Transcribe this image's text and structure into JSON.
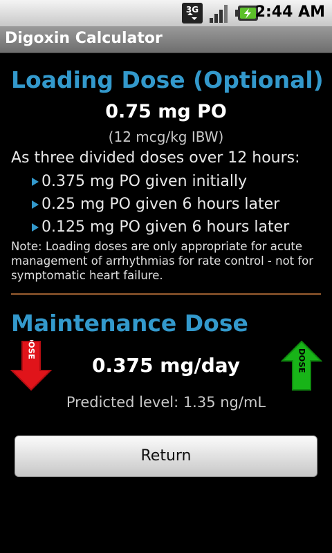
{
  "status_bar": {
    "time": "2:44 AM",
    "network": "3G",
    "icons": [
      "3g-data-icon",
      "signal-icon",
      "battery-charging-icon"
    ]
  },
  "title_bar": {
    "title": "Digoxin Calculator"
  },
  "loading": {
    "heading": "Loading Dose (Optional)",
    "dose": "0.75 mg PO",
    "sub": "(12 mcg/kg IBW)",
    "divided_label": "As three divided doses over 12 hours:",
    "items": [
      "0.375 mg PO given initially",
      "0.25 mg PO given 6 hours later",
      "0.125 mg PO given 6 hours later"
    ],
    "note": "Note: Loading doses are only appropriate for acute management of arrhythmias for rate control - not for symptomatic heart failure."
  },
  "maintenance": {
    "heading": "Maintenance Dose",
    "dose": "0.375 mg/day",
    "predicted": "Predicted level: 1.35 ng/mL",
    "down_arrow_label": "DOSE",
    "up_arrow_label": "DOSE"
  },
  "return_button": {
    "label": "Return"
  },
  "colors": {
    "heading": "#3399cc",
    "divider": "#7a4a26",
    "down_arrow": "#e0141a",
    "up_arrow": "#18b418"
  }
}
